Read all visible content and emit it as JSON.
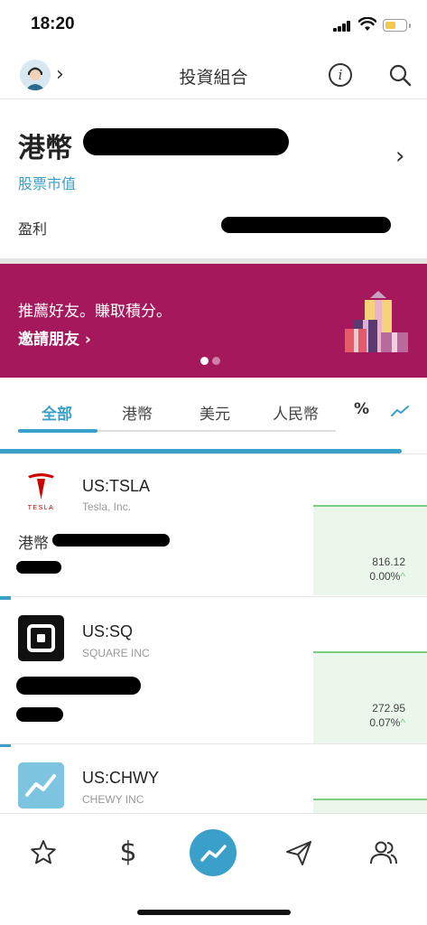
{
  "status": {
    "time": "18:20"
  },
  "nav": {
    "title": "投資組合",
    "info_glyph": "i"
  },
  "portfolio": {
    "title": "港幣",
    "subtitle": "股票市值",
    "profit_label": "盈利"
  },
  "promo": {
    "line1": "推薦好友。賺取積分。",
    "line2": "邀請朋友",
    "line2_chevron": "›",
    "page": "1 of 2"
  },
  "tabs": [
    {
      "label": "全部",
      "active": true
    },
    {
      "label": "港幣"
    },
    {
      "label": "美元"
    },
    {
      "label": "人民幣"
    }
  ],
  "view_toggles": {
    "percent_label": "%",
    "trend_icon": "trend-line-icon"
  },
  "stocks": [
    {
      "ticker": "US:TSLA",
      "name": "Tesla, Inc.",
      "mv_label": "港幣",
      "price": "816.12",
      "change": "0.00%",
      "logo_text": "TESLA",
      "logo": "tesla-logo",
      "accent": "#cc0000"
    },
    {
      "ticker": "US:SQ",
      "name": "SQUARE INC",
      "mv_label": "",
      "price": "272.95",
      "change": "0.07%",
      "logo": "square-logo",
      "accent": "#111111"
    },
    {
      "ticker": "US:CHWY",
      "name": "CHEWY INC",
      "mv_label": "",
      "price": "",
      "change": "",
      "logo": "chart-logo",
      "accent": "#7cc4e0"
    }
  ],
  "bottom_nav": [
    {
      "icon": "star-icon"
    },
    {
      "icon": "dollar-icon",
      "glyph": "$"
    },
    {
      "icon": "trend-icon",
      "active": true
    },
    {
      "icon": "send-icon"
    },
    {
      "icon": "people-icon"
    }
  ],
  "colors": {
    "accent": "#3a9fc9",
    "promo_bg": "#a5185b",
    "up": "#7bcf85"
  }
}
